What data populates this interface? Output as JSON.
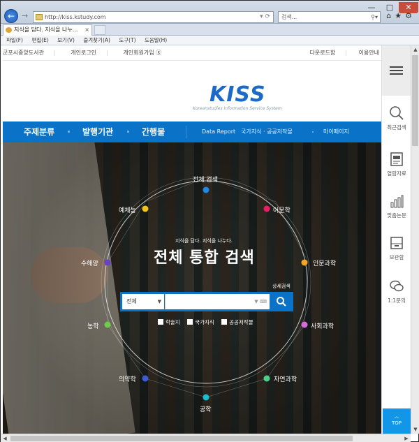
{
  "browser": {
    "url": "http://kiss.kstudy.com",
    "search_placeholder": "검색...",
    "tab_title": "지식을 담다. 지식을 나누...",
    "tab_close": "×",
    "menu": [
      "파일(F)",
      "편집(E)",
      "보기(V)",
      "즐겨찾기(A)",
      "도구(T)",
      "도움말(H)"
    ],
    "window_controls": {
      "minimize": "—",
      "maximize": "□",
      "close": "✕"
    }
  },
  "util_bar": {
    "left": [
      "군포시중앙도서관",
      "개인로그인",
      "개인회원가입 ⓖ"
    ],
    "right": [
      "다운로드함",
      "이용안내"
    ]
  },
  "logo": {
    "text_k": "KI",
    "text_ss": "SS",
    "subtitle": "Koreanstudies Information Service System"
  },
  "nav": {
    "main": [
      "주제분류",
      "발행기관",
      "간행물"
    ],
    "sub": [
      "Data Report",
      "국가지식 · 공공저작물",
      "마이페이지"
    ]
  },
  "hero": {
    "subtitle": "지식을 담다. 지식을 나누다.",
    "title": "전체 통합 검색",
    "advanced_search": "상세검색",
    "categories": [
      {
        "label": "전체 검색",
        "color": "#1e88e5"
      },
      {
        "label": "어문학",
        "color": "#e91e63"
      },
      {
        "label": "인문과학",
        "color": "#f5a623"
      },
      {
        "label": "사회과학",
        "color": "#d66cd9"
      },
      {
        "label": "자연과학",
        "color": "#4ccf8a"
      },
      {
        "label": "공학",
        "color": "#1ebcd1"
      },
      {
        "label": "의약학",
        "color": "#3d5bd6"
      },
      {
        "label": "농학",
        "color": "#6ccf4a"
      },
      {
        "label": "수해양",
        "color": "#6a3fc4"
      },
      {
        "label": "예체능",
        "color": "#f2c318"
      }
    ],
    "search": {
      "select_value": "전체",
      "select_arrow": "▼",
      "query_value": "",
      "tools": "▼ ⌨",
      "button_icon": "🔍"
    },
    "checkboxes": [
      "학술지",
      "국가지식",
      "공공저작물"
    ]
  },
  "quick_panel": {
    "items": [
      "최근검색",
      "열람자료",
      "맞춤논문",
      "보관함",
      "1:1문의"
    ],
    "top_button": "TOP"
  }
}
